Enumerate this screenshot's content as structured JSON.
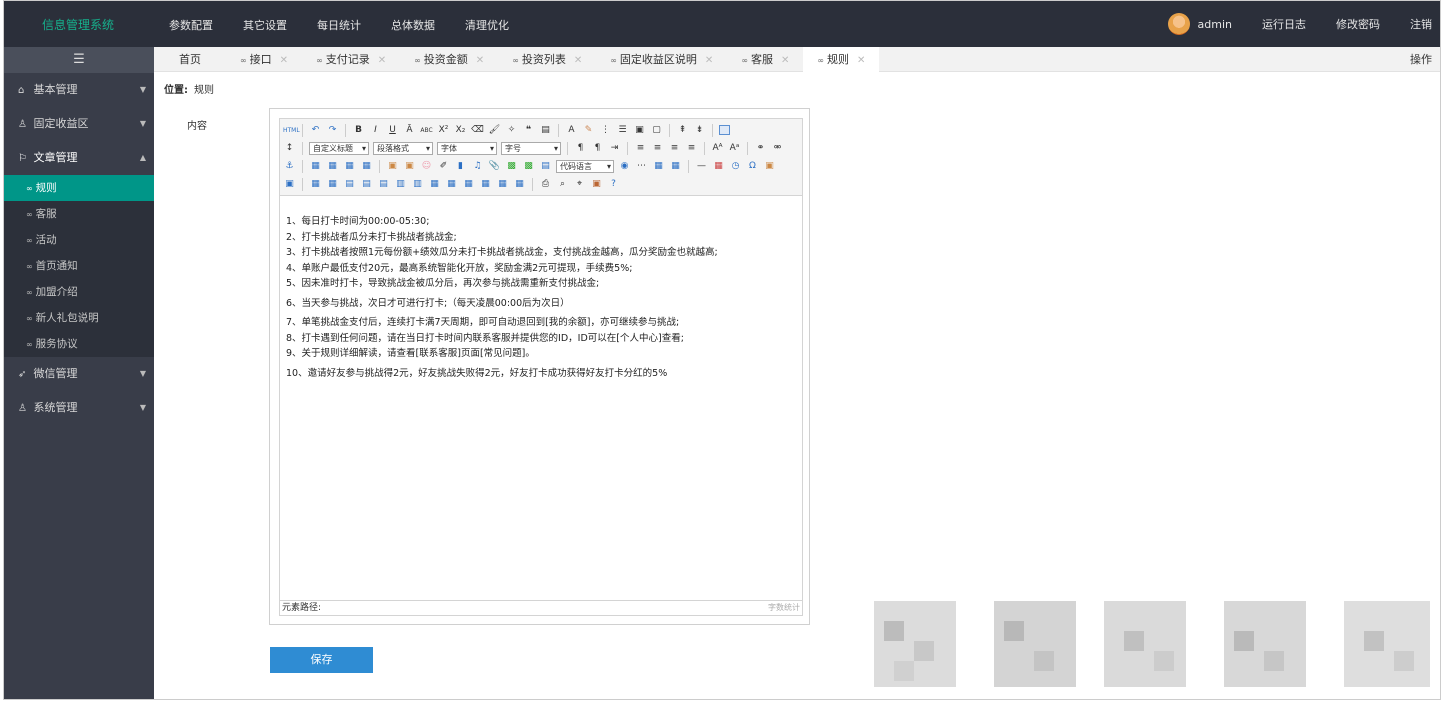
{
  "brand": "信息管理系统",
  "topnav": [
    "参数配置",
    "其它设置",
    "每日统计",
    "总体数据",
    "清理优化"
  ],
  "user": {
    "name": "admin",
    "links": [
      "运行日志",
      "修改密码",
      "注销"
    ]
  },
  "sidebar": {
    "toggle_icon": "menu-toggle-icon",
    "groups": [
      {
        "label": "基本管理",
        "icon": "home-icon"
      },
      {
        "label": "固定收益区",
        "icon": "user-icon"
      },
      {
        "label": "文章管理",
        "icon": "flag-icon",
        "expanded": true,
        "items": [
          "规则",
          "客服",
          "活动",
          "首页通知",
          "加盟介绍",
          "新人礼包说明",
          "服务协议"
        ],
        "active": "规则"
      },
      {
        "label": "微信管理",
        "icon": "send-icon"
      },
      {
        "label": "系统管理",
        "icon": "user-icon"
      }
    ]
  },
  "tabs": {
    "home": "首页",
    "items": [
      "接口",
      "支付记录",
      "投资金额",
      "投资列表",
      "固定收益区说明",
      "客服",
      "规则"
    ],
    "active": "规则",
    "ops": "操作"
  },
  "location": {
    "label": "位置:",
    "value": "规则"
  },
  "form": {
    "content_label": "内容",
    "save_label": "保存"
  },
  "editor": {
    "selects": {
      "heading": "自定义标题",
      "paragraph": "段落格式",
      "font": "字体",
      "size": "字号",
      "code": "代码语言"
    },
    "lines": [
      "1、每日打卡时间为00:00-05:30;",
      "2、打卡挑战者瓜分未打卡挑战者挑战金;",
      "3、打卡挑战者按照1元每份额+绩效瓜分未打卡挑战者挑战金，支付挑战金越高，瓜分奖励金也就越高;",
      "4、单账户最低支付20元，最高系统智能化开放，奖励金满2元可提现，手续费5%;",
      "5、因未准时打卡，导致挑战金被瓜分后，再次参与挑战需重新支付挑战金;",
      "6、当天参与挑战，次日才可进行打卡;（每天凌晨00:00后为次日）",
      "7、单笔挑战金支付后，连续打卡满7天周期，即可自动退回到[我的余额]，亦可继续参与挑战;",
      "8、打卡遇到任何问题，请在当日打卡时间内联系客服并提供您的ID，ID可以在[个人中心]查看;",
      "9、关于规则详细解读，请查看[联系客服]页面[常见问题]。",
      "10、邀请好友参与挑战得2元，好友挑战失败得2元，好友打卡成功获得好友打卡分红的5%"
    ],
    "element_path": "元素路径:",
    "word_count": "字数统计"
  },
  "colors": {
    "topbar": "#2b2f3a",
    "sidebar": "#393d49",
    "active": "#009688",
    "brand": "#16b08c",
    "save": "#2f8cd3"
  }
}
